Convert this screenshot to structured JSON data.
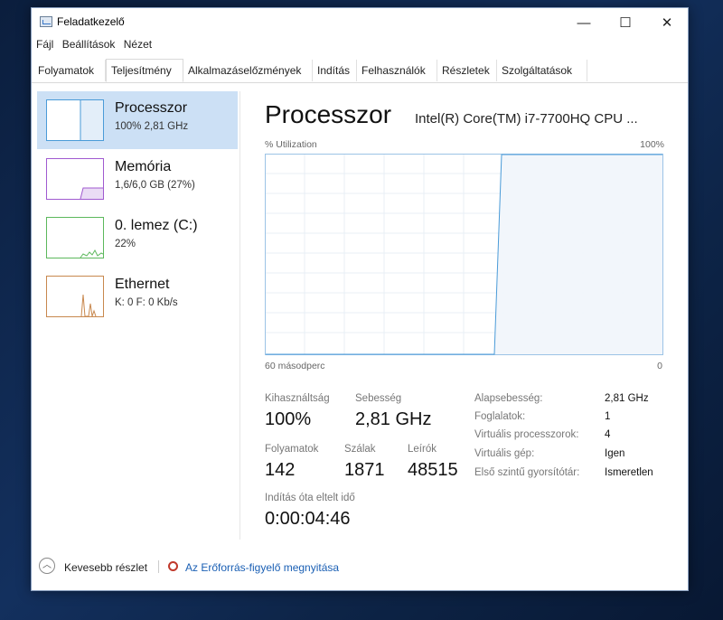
{
  "window": {
    "title": "Feladatkezelő"
  },
  "titlebar_buttons": {
    "minimize": "—",
    "maximize": "☐",
    "close": "✕"
  },
  "menu": [
    "Fájl",
    "Beállítások",
    "Nézet"
  ],
  "tabs": [
    {
      "label": "Folyamatok"
    },
    {
      "label": "Teljesítmény",
      "active": true
    },
    {
      "label": "Alkalmazáselőzmények"
    },
    {
      "label": "Indítás"
    },
    {
      "label": "Felhasználók"
    },
    {
      "label": "Részletek"
    },
    {
      "label": "Szolgáltatások"
    }
  ],
  "sidebar": {
    "items": [
      {
        "title": "Processzor",
        "sub": "100%  2,81 GHz",
        "color": "#4a9bd8"
      },
      {
        "title": "Memória",
        "sub": "1,6/6,0 GB (27%)",
        "color": "#a05ad0"
      },
      {
        "title": "0. lemez (C:)",
        "sub": "22%",
        "color": "#5cb85c"
      },
      {
        "title": "Ethernet",
        "sub": "K: 0  F: 0 Kb/s",
        "color": "#c8884e"
      }
    ]
  },
  "main": {
    "title": "Processzor",
    "cpu_name": "Intel(R) Core(TM) i7-7700HQ CPU ...",
    "util_label": "% Utilization",
    "util_max": "100%",
    "time_left": "60 másodperc",
    "time_right": "0",
    "stats": {
      "utilization": {
        "label": "Kihasználtság",
        "value": "100%"
      },
      "speed": {
        "label": "Sebesség",
        "value": "2,81 GHz"
      },
      "processes": {
        "label": "Folyamatok",
        "value": "142"
      },
      "threads": {
        "label": "Szálak",
        "value": "1871"
      },
      "handles": {
        "label": "Leírók",
        "value": "48515"
      },
      "uptime": {
        "label": "Indítás óta eltelt idő",
        "value": "0:00:04:46"
      }
    },
    "details": [
      {
        "key": "Alapsebesség:",
        "value": "2,81 GHz"
      },
      {
        "key": "Foglalatok:",
        "value": "1"
      },
      {
        "key": "Virtuális processzorok:",
        "value": "4"
      },
      {
        "key": "Virtuális gép:",
        "value": "Igen"
      },
      {
        "key": "Első szintű gyorsítótár:",
        "value": "Ismeretlen"
      }
    ]
  },
  "footer": {
    "fewer_details": "Kevesebb részlet",
    "resource_monitor": "Az Erőforrás-figyelő megnyitása"
  },
  "colors": {
    "accent": "#4a9bd8",
    "graph_fill": "#f1f6fb",
    "link": "#1a5fb4"
  }
}
